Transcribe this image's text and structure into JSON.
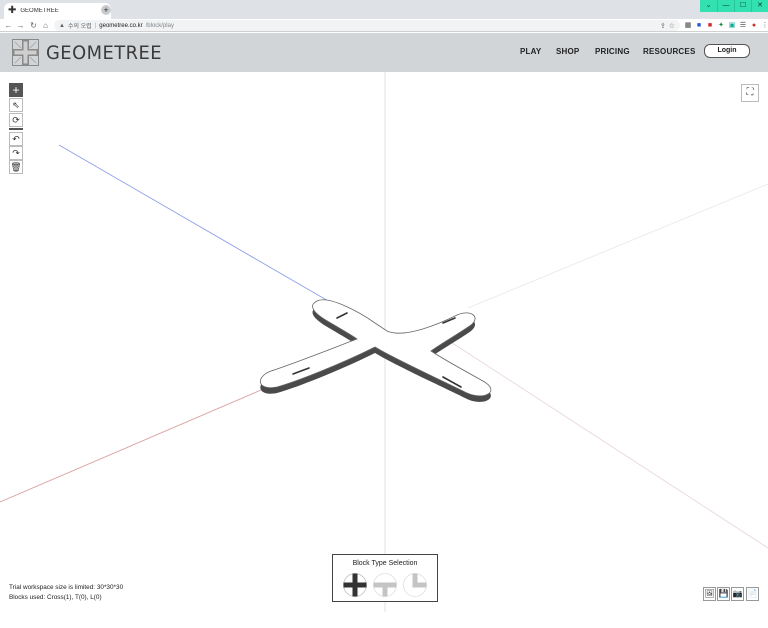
{
  "browser": {
    "tab_title": "GEOMETREE",
    "tab_favicon": "✚",
    "close_glyph": "×",
    "newtab_glyph": "+",
    "security_label": "수의 오렵",
    "url_host": "geometree.co.kr",
    "url_path": "/block/play",
    "window_controls": [
      "⌄",
      "—",
      "☐",
      "✕"
    ]
  },
  "site": {
    "brand": "GEOMETREE",
    "nav": [
      "PLAY",
      "SHOP",
      "PRICING",
      "RESOURCES"
    ],
    "login": "Login"
  },
  "viewport": {
    "tools": [
      "+",
      "⇖",
      "⟳",
      "↶",
      "↷",
      "🗑"
    ],
    "fit_glyph": "⛶"
  },
  "info": {
    "trial": "Trial workspace size is limited: 30*30*30",
    "blocks_used": "Blocks used: Cross(1), T(0), L(0)"
  },
  "block_selection": {
    "title": "Block Type Selection",
    "options": [
      "cross-block-icon",
      "t-block-icon",
      "l-block-icon"
    ]
  },
  "bottom_right_buttons": [
    "🖼",
    "💾",
    "📷",
    "📄"
  ],
  "colors": {
    "header_bg": "#d2d5d8",
    "accent_window": "#33e0b0",
    "axis_x": "#d98a8a",
    "axis_z": "#7d8fe0",
    "block_edge": "#4a4a4a"
  }
}
